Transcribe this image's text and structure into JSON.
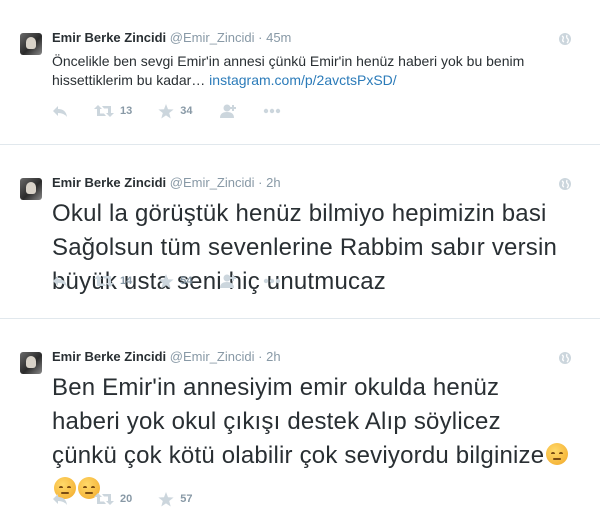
{
  "tweets": [
    {
      "name": "Emir Berke Zincidi",
      "handle": "@Emir_Zincidi",
      "sep": "·",
      "time": "45m",
      "text": "Öncelikle ben sevgi Emir'in annesi çünkü Emir'in henüz haberi yok bu benim hissettiklerim bu kadar…",
      "link": "instagram.com/p/2avctsPxSD/",
      "retweets": "13",
      "favorites": "34"
    },
    {
      "name": "Emir Berke Zincidi",
      "handle": "@Emir_Zincidi",
      "sep": "·",
      "time": "2h",
      "text": "Okul la görüştük henüz bilmiyo hepimizin basi Sağolsun tüm sevenlerine Rabbim sabır versin büyük usta seni hiç unutmucaz",
      "retweets": "14",
      "favorites": "54"
    },
    {
      "name": "Emir Berke Zincidi",
      "handle": "@Emir_Zincidi",
      "sep": "·",
      "time": "2h",
      "text": "Ben Emir'in annesiyim emir okulda henüz haberi yok okul çıkışı destek Alıp söylicez çünkü çok kötü olabilir çok seviyordu bilginize",
      "retweets": "20",
      "favorites": "57"
    }
  ],
  "icons": {
    "reply": "reply-icon",
    "retweet": "retweet-icon",
    "favorite": "star-icon",
    "follow": "follow-icon",
    "more": "more-icon",
    "globe": "globe-icon"
  },
  "colors": {
    "link": "#2b7bb9",
    "muted": "#8899a6",
    "icon": "#ccd6dd",
    "text": "#292f33"
  }
}
